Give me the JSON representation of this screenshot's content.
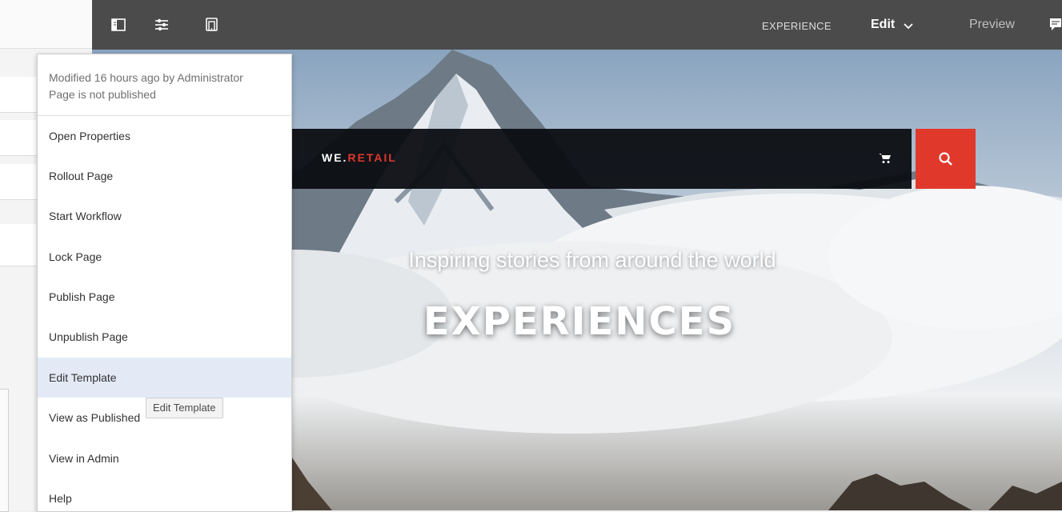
{
  "toolbar": {
    "context_label": "EXPERIENCE",
    "mode_label": "Edit",
    "preview_label": "Preview"
  },
  "page_info_menu": {
    "modified_text": "Modified 16 hours ago by Administrator",
    "publish_status": "Page is not published",
    "items": [
      {
        "label": "Open Properties"
      },
      {
        "label": "Rollout Page"
      },
      {
        "label": "Start Workflow"
      },
      {
        "label": "Lock Page"
      },
      {
        "label": "Publish Page"
      },
      {
        "label": "Unpublish Page"
      },
      {
        "label": "Edit Template",
        "highlighted": true
      },
      {
        "label": "View as Published"
      },
      {
        "label": "View in Admin"
      },
      {
        "label": "Help"
      }
    ]
  },
  "tooltip": {
    "text": "Edit Template"
  },
  "site": {
    "logo_prefix": "WE.",
    "logo_accent": "RETAIL",
    "hero_subtitle": "Inspiring stories from around the world",
    "hero_title": "EXPERIENCES"
  },
  "colors": {
    "toolbar_bg": "#4b4b4b",
    "accent_red": "#e0392b",
    "menu_highlight": "#e3eaf6"
  },
  "icons": {
    "side_panel": "side-panel-toggle-icon",
    "page_properties": "sliders-icon",
    "emulator": "device-emulator-icon",
    "annotations": "annotation-icon",
    "cart": "shopping-cart-icon",
    "search": "search-icon",
    "mode_dropdown": "chevron-down-icon"
  }
}
